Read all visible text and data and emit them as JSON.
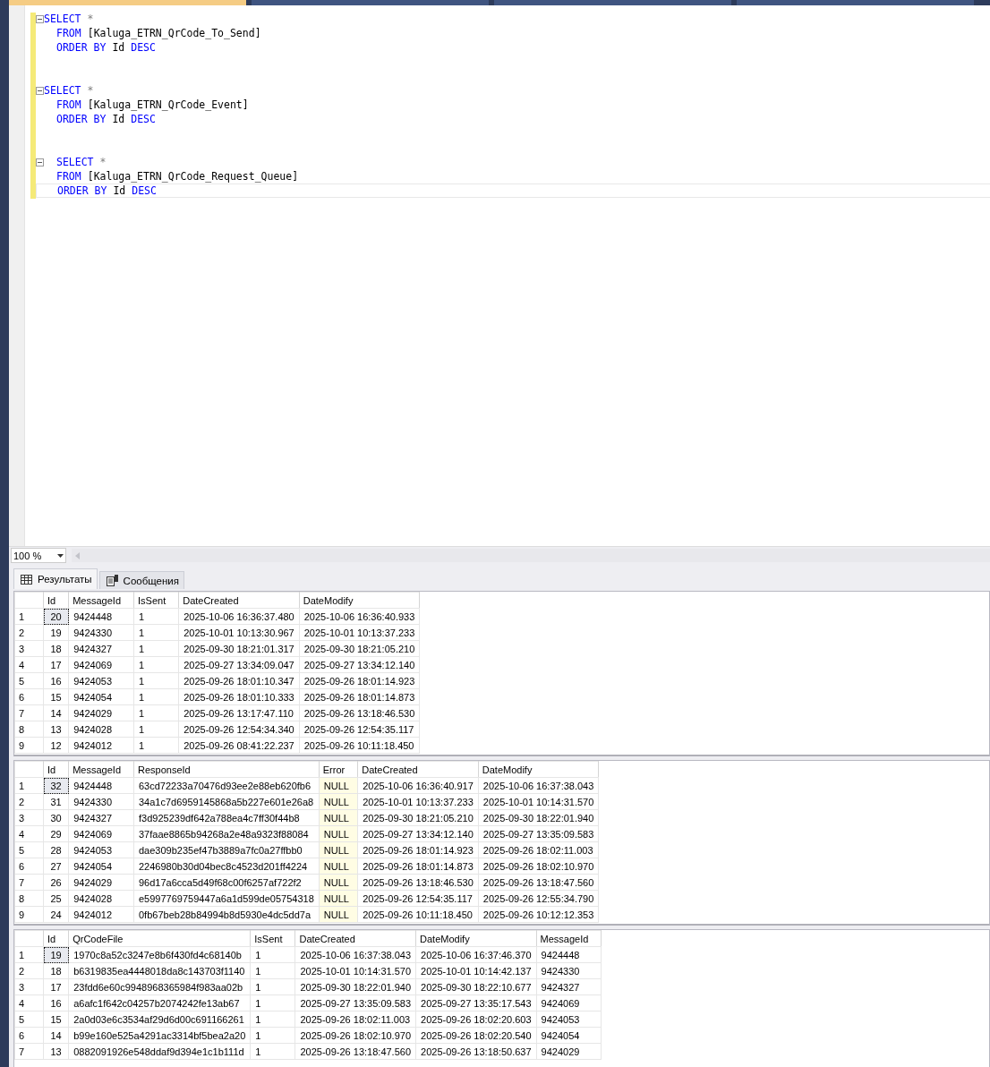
{
  "editor": {
    "lines": [
      {
        "fold": true,
        "indent": false,
        "tokens": [
          {
            "kind": "keyword",
            "text": "SELECT"
          },
          {
            "kind": "operator",
            "text": "*"
          }
        ]
      },
      {
        "fold": false,
        "indent": true,
        "tokens": [
          {
            "kind": "keyword",
            "text": "FROM"
          },
          {
            "kind": "identifier",
            "text": "[Kaluga_ETRN_QrCode_To_Send]"
          }
        ]
      },
      {
        "fold": false,
        "indent": true,
        "tokens": [
          {
            "kind": "keyword",
            "text": "ORDER BY"
          },
          {
            "kind": "identifier",
            "text": "Id"
          },
          {
            "kind": "keyword",
            "text": "DESC"
          }
        ]
      },
      {
        "fold": false
      },
      {
        "fold": false
      },
      {
        "fold": true,
        "indent": false,
        "tokens": [
          {
            "kind": "keyword",
            "text": "SELECT"
          },
          {
            "kind": "operator",
            "text": "*"
          }
        ]
      },
      {
        "fold": false,
        "indent": true,
        "tokens": [
          {
            "kind": "keyword",
            "text": "FROM"
          },
          {
            "kind": "identifier",
            "text": "[Kaluga_ETRN_QrCode_Event]"
          }
        ]
      },
      {
        "fold": false,
        "indent": true,
        "tokens": [
          {
            "kind": "keyword",
            "text": "ORDER BY"
          },
          {
            "kind": "identifier",
            "text": "Id"
          },
          {
            "kind": "keyword",
            "text": "DESC"
          }
        ]
      },
      {
        "fold": false
      },
      {
        "fold": false
      },
      {
        "fold": true,
        "indent": true,
        "tokens": [
          {
            "kind": "keyword",
            "text": "SELECT"
          },
          {
            "kind": "operator",
            "text": "*"
          }
        ]
      },
      {
        "fold": false,
        "indent": true,
        "tokens": [
          {
            "kind": "keyword",
            "text": "FROM"
          },
          {
            "kind": "identifier",
            "text": "[Kaluga_ETRN_QrCode_Request_Queue]"
          }
        ]
      },
      {
        "fold": false,
        "indent": true,
        "current": true,
        "tokens": [
          {
            "kind": "keyword",
            "text": "ORDER BY"
          },
          {
            "kind": "identifier",
            "text": "Id"
          },
          {
            "kind": "keyword",
            "text": "DESC"
          }
        ]
      }
    ]
  },
  "zoom": {
    "value": "100 %"
  },
  "result_tabs": [
    {
      "label": "Результаты",
      "kind": "grid",
      "selected": true
    },
    {
      "label": "Сообщения",
      "kind": "messages",
      "selected": false
    }
  ],
  "grids": [
    {
      "columns": [
        {
          "name": "Id"
        },
        {
          "name": "MessageId"
        },
        {
          "name": "IsSent"
        },
        {
          "name": "DateCreated"
        },
        {
          "name": "DateModify"
        }
      ],
      "rows": [
        {
          "number": "1",
          "focused": true,
          "cells": [
            "20",
            "9424448",
            "1",
            "2025-10-06 16:36:37.480",
            "2025-10-06 16:36:40.933"
          ]
        },
        {
          "number": "2",
          "focused": false,
          "cells": [
            "19",
            "9424330",
            "1",
            "2025-10-01 10:13:30.967",
            "2025-10-01 10:13:37.233"
          ]
        },
        {
          "number": "3",
          "focused": false,
          "cells": [
            "18",
            "9424327",
            "1",
            "2025-09-30 18:21:01.317",
            "2025-09-30 18:21:05.210"
          ]
        },
        {
          "number": "4",
          "focused": false,
          "cells": [
            "17",
            "9424069",
            "1",
            "2025-09-27 13:34:09.047",
            "2025-09-27 13:34:12.140"
          ]
        },
        {
          "number": "5",
          "focused": false,
          "cells": [
            "16",
            "9424053",
            "1",
            "2025-09-26 18:01:10.347",
            "2025-09-26 18:01:14.923"
          ]
        },
        {
          "number": "6",
          "focused": false,
          "cells": [
            "15",
            "9424054",
            "1",
            "2025-09-26 18:01:10.333",
            "2025-09-26 18:01:14.873"
          ]
        },
        {
          "number": "7",
          "focused": false,
          "cells": [
            "14",
            "9424029",
            "1",
            "2025-09-26 13:17:47.110",
            "2025-09-26 13:18:46.530"
          ]
        },
        {
          "number": "8",
          "focused": false,
          "cells": [
            "13",
            "9424028",
            "1",
            "2025-09-26 12:54:34.340",
            "2025-09-26 12:54:35.117"
          ]
        },
        {
          "number": "9",
          "focused": false,
          "cells": [
            "12",
            "9424012",
            "1",
            "2025-09-26 08:41:22.237",
            "2025-09-26 10:11:18.450"
          ]
        }
      ]
    },
    {
      "columns": [
        {
          "name": "Id"
        },
        {
          "name": "MessageId"
        },
        {
          "name": "ResponseId"
        },
        {
          "name": "Error",
          "null_column": true
        },
        {
          "name": "DateCreated"
        },
        {
          "name": "DateModify"
        }
      ],
      "rows": [
        {
          "number": "1",
          "focused": true,
          "cells": [
            "32",
            "9424448",
            "63cd72233a70476d93ee2e88eb620fb6",
            "NULL",
            "2025-10-06 16:36:40.917",
            "2025-10-06 16:37:38.043"
          ]
        },
        {
          "number": "2",
          "focused": false,
          "cells": [
            "31",
            "9424330",
            "34a1c7d6959145868a5b227e601e26a8",
            "NULL",
            "2025-10-01 10:13:37.233",
            "2025-10-01 10:14:31.570"
          ]
        },
        {
          "number": "3",
          "focused": false,
          "cells": [
            "30",
            "9424327",
            "f3d925239df642a788ea4c7ff30f44b8",
            "NULL",
            "2025-09-30 18:21:05.210",
            "2025-09-30 18:22:01.940"
          ]
        },
        {
          "number": "4",
          "focused": false,
          "cells": [
            "29",
            "9424069",
            "37faae8865b94268a2e48a9323f88084",
            "NULL",
            "2025-09-27 13:34:12.140",
            "2025-09-27 13:35:09.583"
          ]
        },
        {
          "number": "5",
          "focused": false,
          "cells": [
            "28",
            "9424053",
            "dae309b235ef47b3889a7fc0a27ffbb0",
            "NULL",
            "2025-09-26 18:01:14.923",
            "2025-09-26 18:02:11.003"
          ]
        },
        {
          "number": "6",
          "focused": false,
          "cells": [
            "27",
            "9424054",
            "2246980b30d04bec8c4523d201ff4224",
            "NULL",
            "2025-09-26 18:01:14.873",
            "2025-09-26 18:02:10.970"
          ]
        },
        {
          "number": "7",
          "focused": false,
          "cells": [
            "26",
            "9424029",
            "96d17a6cca5d49f68c00f6257af722f2",
            "NULL",
            "2025-09-26 13:18:46.530",
            "2025-09-26 13:18:47.560"
          ]
        },
        {
          "number": "8",
          "focused": false,
          "cells": [
            "25",
            "9424028",
            "e5997769759447a6a1d599de05754318",
            "NULL",
            "2025-09-26 12:54:35.117",
            "2025-09-26 12:55:34.790"
          ]
        },
        {
          "number": "9",
          "focused": false,
          "cells": [
            "24",
            "9424012",
            "0fb67beb28b84994b8d5930e4dc5dd7a",
            "NULL",
            "2025-09-26 10:11:18.450",
            "2025-09-26 10:12:12.353"
          ]
        }
      ]
    },
    {
      "columns": [
        {
          "name": "Id"
        },
        {
          "name": "QrCodeFile"
        },
        {
          "name": "IsSent"
        },
        {
          "name": "DateCreated"
        },
        {
          "name": "DateModify"
        },
        {
          "name": "MessageId"
        }
      ],
      "rows": [
        {
          "number": "1",
          "focused": true,
          "cells": [
            "19",
            "1970c8a52c3247e8b6f430fd4c68140b",
            "1",
            "2025-10-06 16:37:38.043",
            "2025-10-06 16:37:46.370",
            "9424448"
          ]
        },
        {
          "number": "2",
          "focused": false,
          "cells": [
            "18",
            "b6319835ea4448018da8c143703f1140",
            "1",
            "2025-10-01 10:14:31.570",
            "2025-10-01 10:14:42.137",
            "9424330"
          ]
        },
        {
          "number": "3",
          "focused": false,
          "cells": [
            "17",
            "23fdd6e60c9948968365984f983aa02b",
            "1",
            "2025-09-30 18:22:01.940",
            "2025-09-30 18:22:10.677",
            "9424327"
          ]
        },
        {
          "number": "4",
          "focused": false,
          "cells": [
            "16",
            "a6afc1f642c04257b2074242fe13ab67",
            "1",
            "2025-09-27 13:35:09.583",
            "2025-09-27 13:35:17.543",
            "9424069"
          ]
        },
        {
          "number": "5",
          "focused": false,
          "cells": [
            "15",
            "2a0d03e6c3534af29d6d00c691166261",
            "1",
            "2025-09-26 18:02:11.003",
            "2025-09-26 18:02:20.603",
            "9424053"
          ]
        },
        {
          "number": "6",
          "focused": false,
          "cells": [
            "14",
            "b99e160e525a4291ac3314bf5bea2a20",
            "1",
            "2025-09-26 18:02:10.970",
            "2025-09-26 18:02:20.540",
            "9424054"
          ]
        },
        {
          "number": "7",
          "focused": false,
          "cells": [
            "13",
            "0882091926e548ddaf9d394e1c1b111d",
            "1",
            "2025-09-26 13:18:47.560",
            "2025-09-26 13:18:50.637",
            "9424029"
          ]
        }
      ]
    }
  ]
}
